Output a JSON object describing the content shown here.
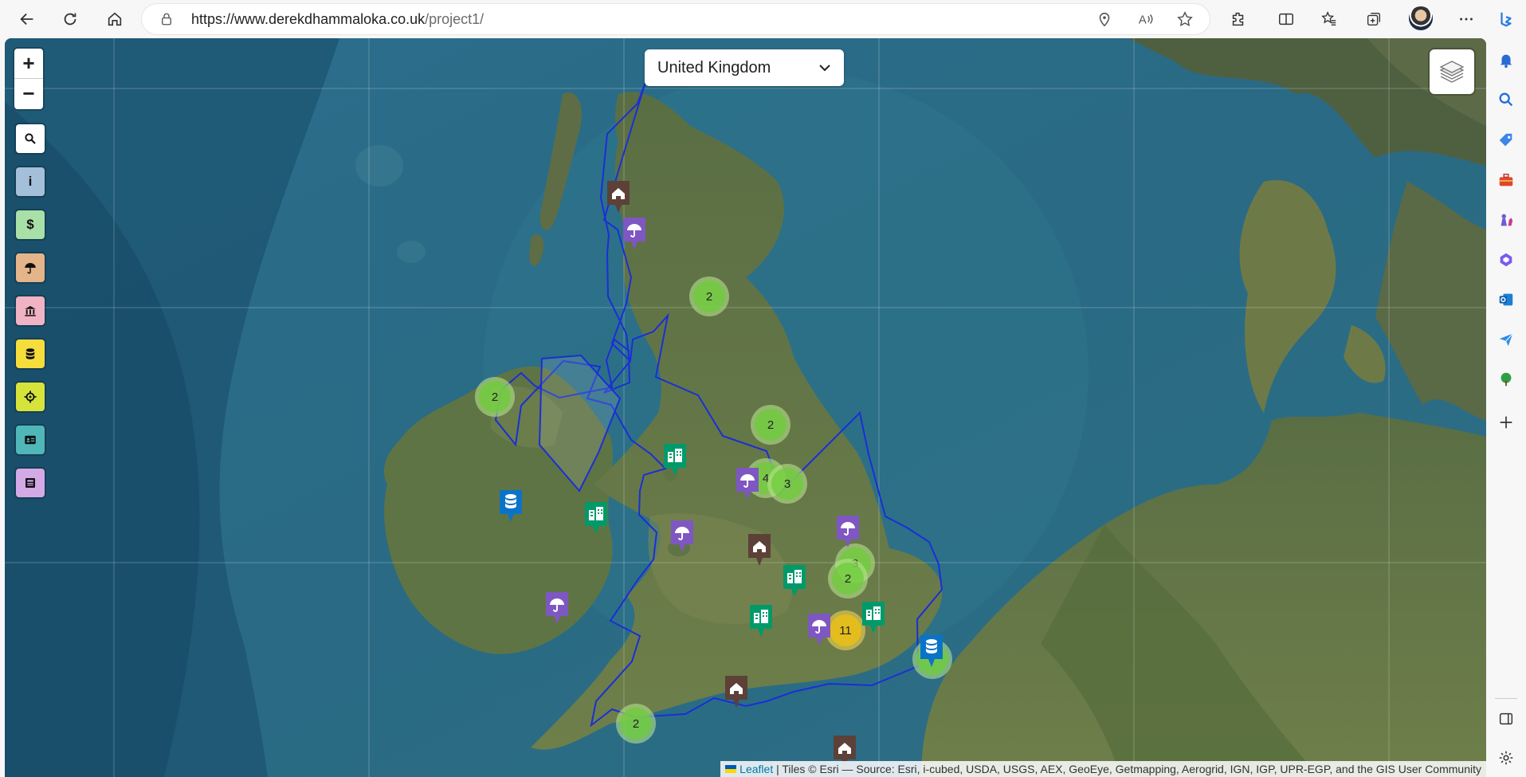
{
  "browser": {
    "url_host": "https://www.derekdhammaloka.co.uk",
    "url_path": "/project1/"
  },
  "map": {
    "zoom_in_label": "+",
    "zoom_out_label": "−",
    "country_select": {
      "selected": "United Kingdom"
    },
    "controls": [
      {
        "name": "search-control-button",
        "icon": "search-icon",
        "bg": "#ffffff"
      },
      {
        "name": "info-control-button",
        "icon": "info-icon",
        "label": "i",
        "bg": "#a3bfd9"
      },
      {
        "name": "currency-control-button",
        "icon": "dollar-icon",
        "label": "$",
        "bg": "#a8e0a8"
      },
      {
        "name": "weather-control-button",
        "icon": "umbrella-icon",
        "bg": "#e4b48a"
      },
      {
        "name": "institutions-control-button",
        "icon": "landmark-icon",
        "bg": "#f0b3c4"
      },
      {
        "name": "database-control-button",
        "icon": "database-icon",
        "bg": "#f5dd3b"
      },
      {
        "name": "locate-control-button",
        "icon": "crosshair-icon",
        "bg": "#d5e33a"
      },
      {
        "name": "id-card-control-button",
        "icon": "id-card-icon",
        "bg": "#4fb7b7"
      },
      {
        "name": "news-control-button",
        "icon": "newspaper-icon",
        "bg": "#d3a9e6"
      }
    ],
    "clusters": [
      {
        "count": "2",
        "type": "small"
      },
      {
        "count": "2",
        "type": "small"
      },
      {
        "count": "2",
        "type": "small"
      },
      {
        "count": "4",
        "type": "small"
      },
      {
        "count": "3",
        "type": "small"
      },
      {
        "count": "3",
        "type": "small"
      },
      {
        "count": "2",
        "type": "small"
      },
      {
        "count": "11",
        "type": "large"
      },
      {
        "count": "2",
        "type": "small"
      },
      {
        "count": "",
        "type": "small"
      }
    ],
    "attribution": {
      "leaflet": "Leaflet",
      "text": " | Tiles © Esri — Source: Esri, i-cubed, USDA, USGS, AEX, GeoEye, Getmapping, Aerogrid, IGN, IGP, UPR-EGP, and the GIS User Community"
    },
    "colors": {
      "house_marker": "#5d4037",
      "umbrella_marker": "#7e57c2",
      "building_marker": "#009a6a",
      "database_marker": "#0a73c8",
      "border": "#1a2fd6"
    }
  }
}
